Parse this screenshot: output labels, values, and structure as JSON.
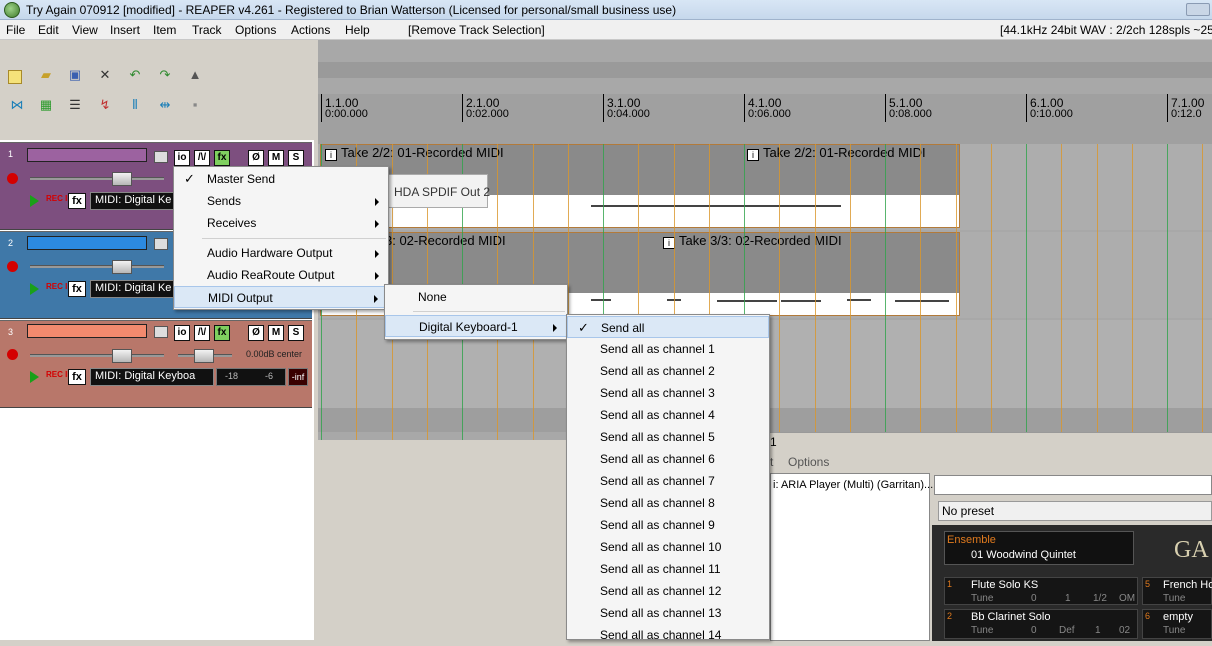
{
  "window": {
    "title": "Try Again 070912 [modified] - REAPER v4.261 - Registered to Brian Watterson (Licensed for personal/small business use)"
  },
  "menubar": {
    "items": [
      "File",
      "Edit",
      "View",
      "Insert",
      "Item",
      "Track",
      "Options",
      "Actions",
      "Help"
    ],
    "action": "[Remove Track Selection]",
    "status": "[44.1kHz 24bit WAV : 2/2ch 128spls ~25/"
  },
  "toolbar": {
    "icons": [
      "new-project-icon",
      "open-project-icon",
      "save-icon",
      "tools-icon",
      "undo-icon",
      "redo-icon",
      "metronome-icon",
      "ripple-icon",
      "grid-icon",
      "tracks-icon",
      "auto-crossfade-icon",
      "snap-icon",
      "split-icon",
      "lock-icon"
    ]
  },
  "ruler": {
    "marks": [
      {
        "bar": "1.1.00",
        "time": "0:00.000"
      },
      {
        "bar": "2.1.00",
        "time": "0:02.000"
      },
      {
        "bar": "3.1.00",
        "time": "0:04.000"
      },
      {
        "bar": "4.1.00",
        "time": "0:06.000"
      },
      {
        "bar": "5.1.00",
        "time": "0:08.000"
      },
      {
        "bar": "6.1.00",
        "time": "0:10.000"
      },
      {
        "bar": "7.1.00",
        "time": "0:12.0"
      }
    ]
  },
  "tracks": [
    {
      "num": "1",
      "color": "#7d4f7f",
      "name_color": "#9c62a0",
      "midi": "MIDI: Digital Ke"
    },
    {
      "num": "2",
      "color": "#3f78a8",
      "name_color": "#2c8ae0",
      "midi": "MIDI: Digital Ke"
    },
    {
      "num": "3",
      "color": "#b8776a",
      "name_color": "#f28a6e",
      "midi": "MIDI: Digital Keyboa",
      "volume": "0.00dB center",
      "meter_l": "-18",
      "meter_r": "-6",
      "peak": "-inf"
    }
  ],
  "track_buttons": {
    "io": "io",
    "env": "/\\/",
    "fx": "fx",
    "mute": "M",
    "solo": "S",
    "phase": "Ø",
    "recin": "REC IN"
  },
  "items": {
    "t1a": "Take 2/2: 01-Recorded MIDI",
    "t1b": "Take 2/2: 01-Recorded MIDI",
    "t2a": "3: 02-Recorded MIDI",
    "t2b": "Take 3/3: 02-Recorded MIDI",
    "hda": "HDA SPDIF Out 2"
  },
  "fx_window": {
    "menu_options": "Options",
    "menu_t": "t",
    "title_num": "1",
    "plugin": "i: ARIA Player (Multi) (Garritan)...",
    "preset": "No preset",
    "ensemble_label": "Ensemble",
    "ensemble_value": "01 Woodwind Quintet",
    "brand": "GA",
    "slots": [
      {
        "num": "1",
        "name": "Flute Solo KS",
        "tune": "Tune",
        "v1": "0",
        "v2": "1",
        "v3": "1/2",
        "v4": "OM"
      },
      {
        "num": "2",
        "name": "Bb Clarinet Solo",
        "tune": "Tune",
        "v1": "0",
        "v2": "Def",
        "v3": "1",
        "v4": "02"
      }
    ],
    "slots_right": [
      {
        "num": "5",
        "name": "French Ho",
        "tune": "Tune"
      },
      {
        "num": "6",
        "name": "empty",
        "tune": "Tune"
      }
    ]
  },
  "context_menu": {
    "items": [
      {
        "label": "Master Send",
        "checked": true
      },
      {
        "label": "Sends",
        "submenu": true
      },
      {
        "label": "Receives",
        "submenu": true
      },
      {
        "label": "Audio Hardware Output",
        "submenu": true
      },
      {
        "label": "Audio ReaRoute Output",
        "submenu": true
      },
      {
        "label": "MIDI Output",
        "submenu": true,
        "highlighted": true
      }
    ]
  },
  "midi_output_menu": {
    "items": [
      {
        "label": "None"
      },
      {
        "label": "Digital Keyboard-1",
        "submenu": true,
        "highlighted": true
      }
    ]
  },
  "device_menu": {
    "items": [
      "Send all",
      "Send all as channel 1",
      "Send all as channel 2",
      "Send all as channel 3",
      "Send all as channel 4",
      "Send all as channel 5",
      "Send all as channel 6",
      "Send all as channel 7",
      "Send all as channel 8",
      "Send all as channel 9",
      "Send all as channel 10",
      "Send all as channel 11",
      "Send all as channel 12",
      "Send all as channel 13",
      "Send all as channel 14"
    ],
    "checked_index": 0
  }
}
